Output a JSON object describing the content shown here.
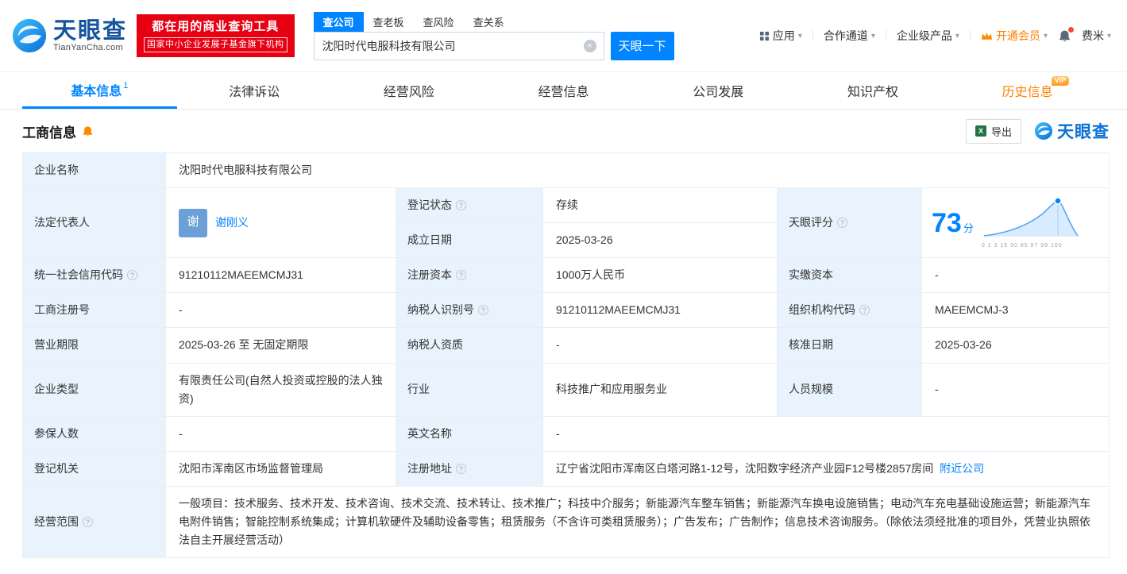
{
  "colors": {
    "brand_blue": "#0084ff",
    "link_blue": "#0084ff",
    "vip_orange": "#ff8000",
    "status_green": "#00b365",
    "promo_red": "#e60012",
    "label_bg": "#e8f3fd"
  },
  "icons": {
    "clear": "×",
    "caret": "▾",
    "excel": "X",
    "question": "?"
  },
  "brand": {
    "name": "天眼查",
    "domain": "TianYanCha.com",
    "slogan1": "都在用的商业查询工具",
    "slogan2": "国家中小企业发展子基金旗下机构"
  },
  "search": {
    "tabs": [
      "查公司",
      "查老板",
      "查风险",
      "查关系"
    ],
    "input_value": "沈阳时代电服科技有限公司",
    "button_label": "天眼一下"
  },
  "top_nav": {
    "apps": "应用",
    "cooperation": "合作通道",
    "enterprise": "企业级产品",
    "vip": "开通会员",
    "user": "费米"
  },
  "page_tabs": [
    {
      "label": "基本信息",
      "badge": "1"
    },
    {
      "label": "法律诉讼"
    },
    {
      "label": "经营风险"
    },
    {
      "label": "经营信息"
    },
    {
      "label": "公司发展"
    },
    {
      "label": "知识产权"
    },
    {
      "label": "历史信息",
      "vip_badge": "VIP"
    }
  ],
  "section": {
    "title": "工商信息",
    "export_label": "导出",
    "watermark": "天眼查"
  },
  "score": {
    "value": "73",
    "unit": "分",
    "axis": "0 1 3 15 50 85 97 99 100"
  },
  "info": {
    "company_name_label": "企业名称",
    "company_name": "沈阳时代电服科技有限公司",
    "legal_rep_label": "法定代表人",
    "legal_rep_avatar": "谢",
    "legal_rep_name": "谢刚义",
    "reg_status_label": "登记状态",
    "reg_status": "存续",
    "score_label": "天眼评分",
    "est_date_label": "成立日期",
    "est_date": "2025-03-26",
    "credit_code_label": "统一社会信用代码",
    "credit_code": "91210112MAEEMCMJ31",
    "reg_capital_label": "注册资本",
    "reg_capital": "1000万人民币",
    "paid_capital_label": "实缴资本",
    "paid_capital": "-",
    "reg_no_label": "工商注册号",
    "reg_no": "-",
    "taxpayer_id_label": "纳税人识别号",
    "taxpayer_id": "91210112MAEEMCMJ31",
    "org_code_label": "组织机构代码",
    "org_code": "MAEEMCMJ-3",
    "term_label": "营业期限",
    "term": "2025-03-26 至 无固定期限",
    "taxpayer_quality_label": "纳税人资质",
    "taxpayer_quality": "-",
    "approval_date_label": "核准日期",
    "approval_date": "2025-03-26",
    "company_type_label": "企业类型",
    "company_type": "有限责任公司(自然人投资或控股的法人独资)",
    "industry_label": "行业",
    "industry": "科技推广和应用服务业",
    "staff_label": "人员规模",
    "staff": "-",
    "insured_label": "参保人数",
    "insured": "-",
    "en_name_label": "英文名称",
    "en_name": "-",
    "authority_label": "登记机关",
    "authority": "沈阳市浑南区市场监督管理局",
    "address_label": "注册地址",
    "address": "辽宁省沈阳市浑南区白塔河路1-12号，沈阳数字经济产业园F12号楼2857房间",
    "nearby_link": "附近公司",
    "scope_label": "经营范围",
    "scope": "一般项目：技术服务、技术开发、技术咨询、技术交流、技术转让、技术推广；科技中介服务；新能源汽车整车销售；新能源汽车换电设施销售；电动汽车充电基础设施运营；新能源汽车电附件销售；智能控制系统集成；计算机软硬件及辅助设备零售；租赁服务（不含许可类租赁服务）；广告发布；广告制作；信息技术咨询服务。（除依法须经批准的项目外，凭营业执照依法自主开展经营活动）"
  }
}
